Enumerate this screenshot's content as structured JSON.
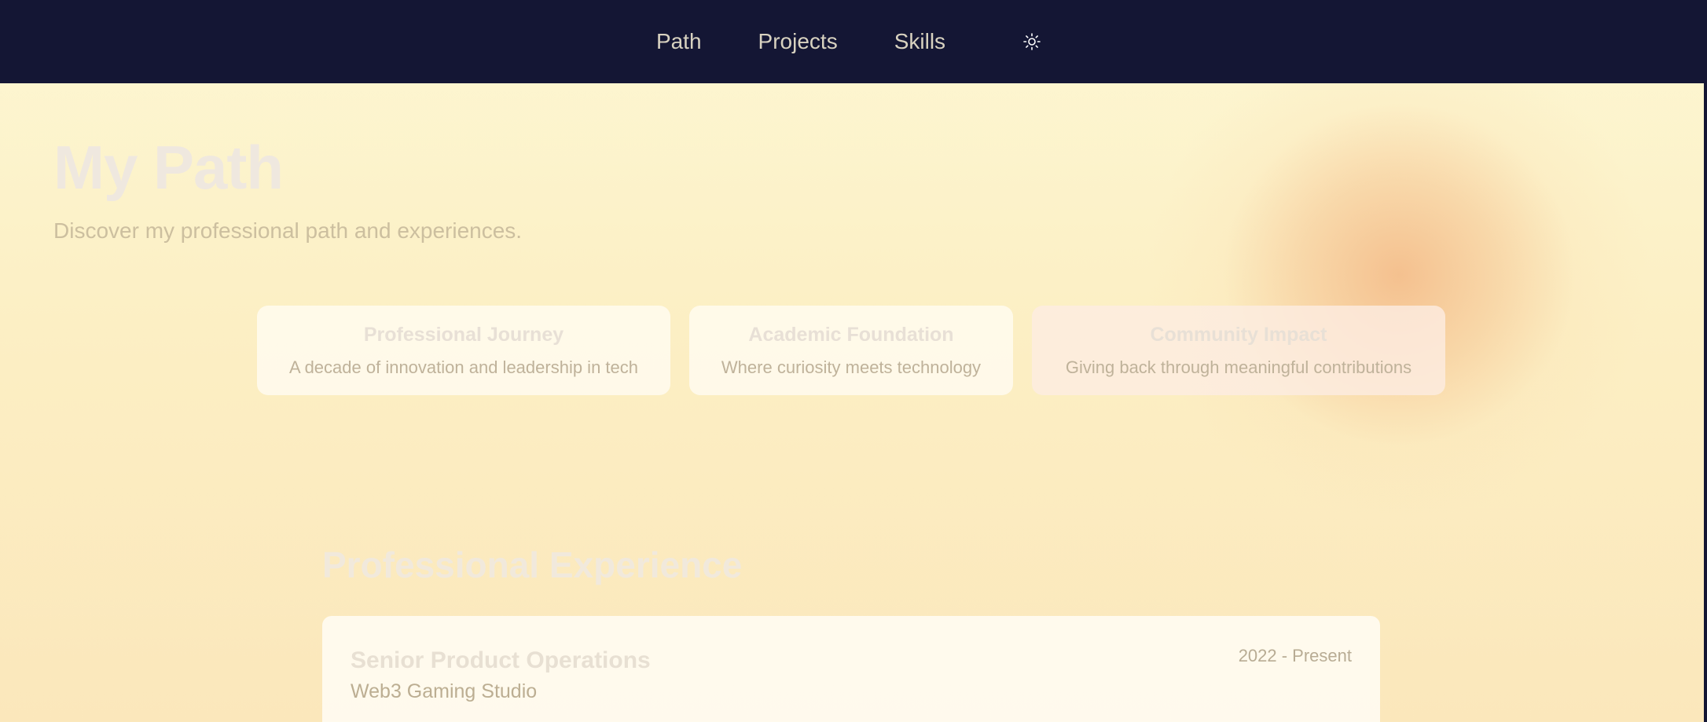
{
  "nav": {
    "items": [
      {
        "label": "Path"
      },
      {
        "label": "Projects"
      },
      {
        "label": "Skills"
      }
    ],
    "theme_toggle_icon": "sun-icon"
  },
  "hero": {
    "title": "My Path",
    "subtitle": "Discover my professional path and experiences."
  },
  "cards": [
    {
      "title": "Professional Journey",
      "description": "A decade of innovation and leadership in tech"
    },
    {
      "title": "Academic Foundation",
      "description": "Where curiosity meets technology"
    },
    {
      "title": "Community Impact",
      "description": "Giving back through meaningful contributions"
    }
  ],
  "experience": {
    "section_title": "Professional Experience",
    "items": [
      {
        "role": "Senior Product Operations",
        "company": "Web3 Gaming Studio",
        "dates": "2022 - Present"
      }
    ]
  },
  "colors": {
    "navbar_bg": "#141634",
    "page_bg_top": "#fdf7d3",
    "page_bg_bottom": "#fbe7bb",
    "glow": "#f4be8c"
  }
}
